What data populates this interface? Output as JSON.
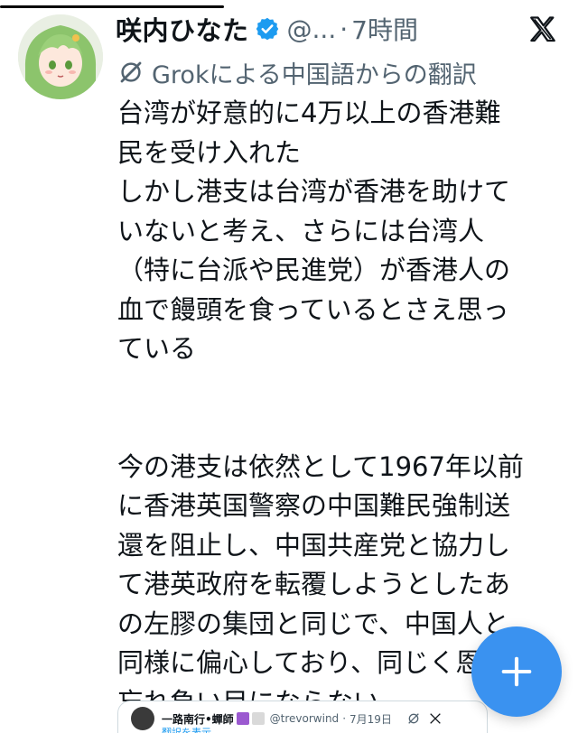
{
  "post": {
    "display_name": "咲内ひなた",
    "handle": "@...",
    "separator": "·",
    "time": "7時間",
    "translation_label": "Grokによる中国語からの翻訳",
    "paragraph1": "台湾が好意的に4万以上の香港難\n民を受け入れた\nしかし港支は台湾が香港を助けて\nいないと考え、さらには台湾人\n（特に台派や民進党）が香港人の\n血で饅頭を食っているとさえ思っ\nている",
    "paragraph2": "今の港支は依然として1967年以前\nに香港英国警察の中国難民強制送\n還を阻止し、中国共産党と協力し\nて港英政府を転覆しようとしたあ\nの左膠の集団と同じで、中国人と\n同様に偏心しており、同じく恩を\n忘れ負い目にならない。"
  },
  "quote": {
    "name": "一路南行•蟬師",
    "handle": "@trevorwind",
    "separator": "·",
    "date": "7月19日",
    "subtext": "翻訳を表示"
  },
  "icons": {
    "verified": "verified-badge-icon",
    "x_logo": "x-logo-icon",
    "grok": "grok-icon",
    "compose": "plus-icon"
  },
  "colors": {
    "accent": "#1d9bf0",
    "fab": "#3a92f0",
    "muted_text": "#536471",
    "text": "#0f1419"
  }
}
